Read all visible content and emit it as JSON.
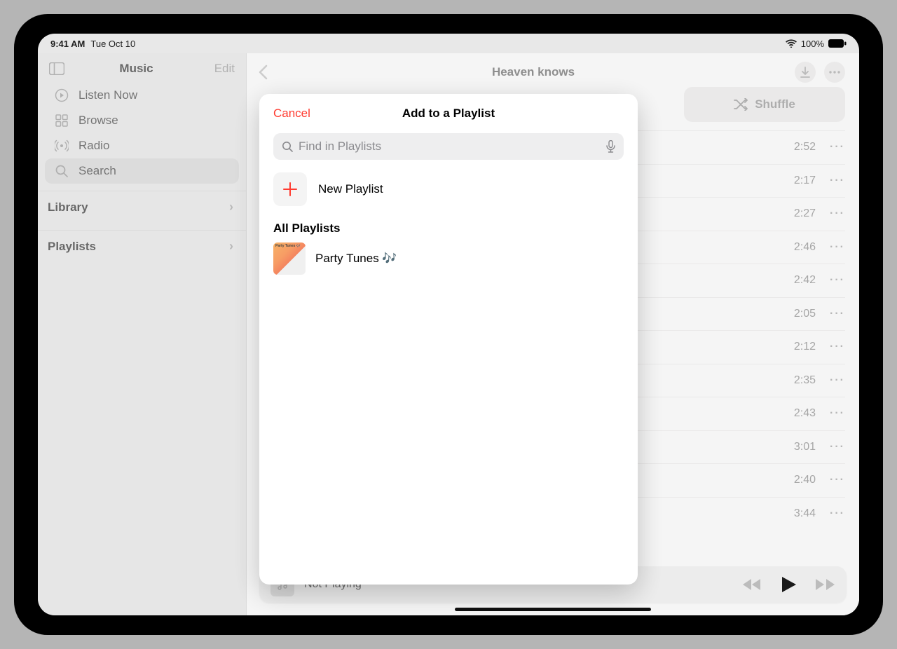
{
  "status": {
    "time": "9:41 AM",
    "date": "Tue Oct 10",
    "battery": "100%"
  },
  "sidebar": {
    "title": "Music",
    "edit": "Edit",
    "items": [
      {
        "label": "Listen Now"
      },
      {
        "label": "Browse"
      },
      {
        "label": "Radio"
      },
      {
        "label": "Search"
      }
    ],
    "sections": [
      {
        "label": "Library"
      },
      {
        "label": "Playlists"
      }
    ]
  },
  "content": {
    "title": "Heaven knows",
    "shuffle": "Shuffle",
    "tracks": [
      {
        "duration": "2:52"
      },
      {
        "duration": "2:17"
      },
      {
        "duration": "2:27"
      },
      {
        "duration": "2:46"
      },
      {
        "duration": "2:42"
      },
      {
        "duration": "2:05"
      },
      {
        "duration": "2:12"
      },
      {
        "duration": "2:35"
      },
      {
        "duration": "2:43"
      },
      {
        "duration": "3:01"
      },
      {
        "duration": "2:40"
      },
      {
        "duration": "3:44"
      }
    ]
  },
  "now_playing": {
    "label": "Not Playing"
  },
  "modal": {
    "cancel": "Cancel",
    "title": "Add to a Playlist",
    "search_placeholder": "Find in Playlists",
    "new_playlist": "New Playlist",
    "section": "All Playlists",
    "playlists": [
      {
        "name": "Party Tunes 🎶",
        "thumb_label": "Party Tunes 🎶"
      }
    ]
  }
}
